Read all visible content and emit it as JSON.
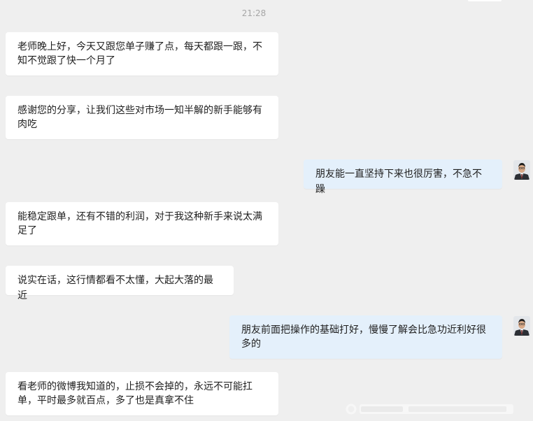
{
  "chat": {
    "timestamp": "21:28",
    "messages": [
      {
        "direction": "incoming",
        "text": "老师晚上好，今天又跟您单子赚了点，每天都跟一跟，不知不觉跟了快一个月了"
      },
      {
        "direction": "incoming",
        "text": "感谢您的分享，让我们这些对市场一知半解的新手能够有肉吃"
      },
      {
        "direction": "outgoing",
        "text": "朋友能一直坚持下来也很厉害，不急不躁"
      },
      {
        "direction": "incoming",
        "text": "能稳定跟单，还有不错的利润，对于我这种新手来说太满足了"
      },
      {
        "direction": "incoming",
        "text": "说实在话，这行情都看不太懂，大起大落的最近"
      },
      {
        "direction": "outgoing",
        "text": "朋友前面把操作的基础打好，慢慢了解会比急功近利好很多的"
      },
      {
        "direction": "incoming",
        "text": "看老师的微博我知道的，止损不会掉的，永远不可能扛单，平时最多就百点，多了也是真拿不住"
      }
    ]
  },
  "theme": {
    "background": "#efefef",
    "incoming_bubble": "#ffffff",
    "outgoing_bubble": "#e4f0fb",
    "text": "#1f1f1f",
    "timestamp": "#a6a6a6"
  },
  "icons": {
    "sender_avatar": "person-avatar-icon"
  }
}
